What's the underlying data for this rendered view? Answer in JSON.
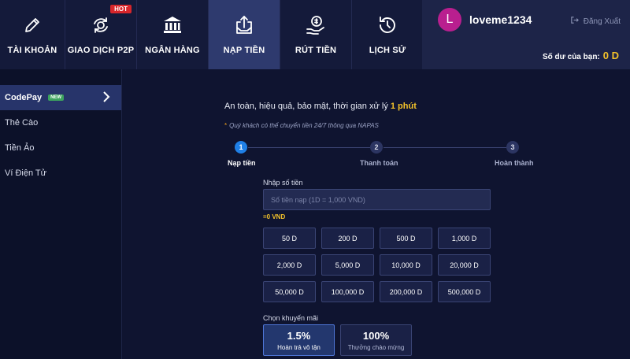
{
  "nav": {
    "items": [
      {
        "label": "TÀI KHOẢN",
        "icon": "pencil-icon"
      },
      {
        "label": "GIAO DỊCH P2P",
        "icon": "exchange-icon",
        "badge": "HOT"
      },
      {
        "label": "NGÂN HÀNG",
        "icon": "bank-icon"
      },
      {
        "label": "NẠP TIỀN",
        "icon": "deposit-icon",
        "active": true
      },
      {
        "label": "RÚT TIỀN",
        "icon": "withdraw-icon"
      },
      {
        "label": "LỊCH SỬ",
        "icon": "history-icon"
      }
    ]
  },
  "account": {
    "avatar_letter": "L",
    "username": "loveme1234",
    "logout_label": "Đăng Xuất",
    "balance_label": "Số dư của bạn:",
    "balance_value": "0 D"
  },
  "sidebar": {
    "items": [
      {
        "label": "CodePay",
        "badge": "NEW",
        "active": true
      },
      {
        "label": "Thẻ Cào"
      },
      {
        "label": "Tiền Ảo"
      },
      {
        "label": "Ví Điện Tử"
      }
    ]
  },
  "main": {
    "headline_text": "An toàn, hiệu quả, bảo mật, thời gian xử lý ",
    "headline_highlight": "1 phút",
    "note_star": "*",
    "note_text": "Quý khách có thể chuyển tiền 24/7 thông qua NAPAS",
    "steps": [
      {
        "num": "1",
        "label": "Nạp tiền"
      },
      {
        "num": "2",
        "label": "Thanh toán"
      },
      {
        "num": "3",
        "label": "Hoàn thành"
      }
    ],
    "amount_label": "Nhập số tiền",
    "amount_placeholder": "Số tiền nạp (1D = 1,000 VND)",
    "amount_value": "",
    "converted": "=0 VND",
    "amounts": [
      "50 D",
      "200 D",
      "500 D",
      "1,000 D",
      "2,000 D",
      "5,000 D",
      "10,000 D",
      "20,000 D",
      "50,000 D",
      "100,000 D",
      "200,000 D",
      "500,000 D"
    ],
    "promo_label": "Chọn khuyến mãi",
    "promos": [
      {
        "pct": "1.5%",
        "desc": "Hoàn trả vô tận"
      },
      {
        "pct": "100%",
        "desc": "Thưởng chào mừng"
      }
    ]
  },
  "colors": {
    "accent_gold": "#f3c22a",
    "active_blue": "#1f7fe6",
    "hot_red": "#d7262b",
    "new_green": "#3ca35e",
    "avatar_magenta": "#b91f8f"
  }
}
